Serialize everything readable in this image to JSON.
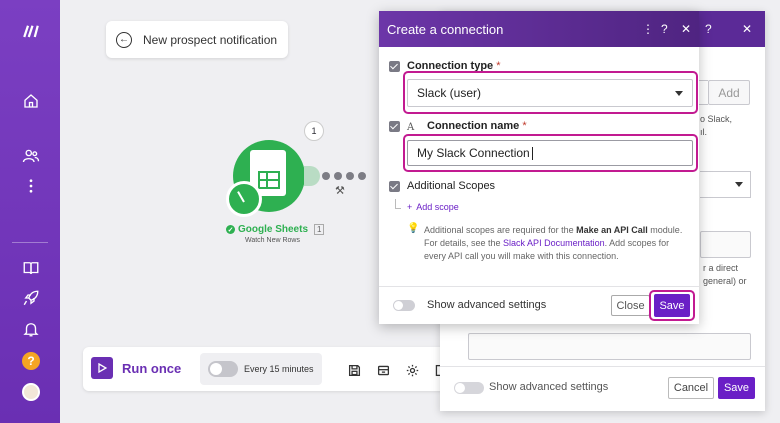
{
  "scenario": {
    "title": "New prospect notification"
  },
  "module": {
    "name": "Google Sheets",
    "index": "1",
    "subtitle": "Watch New Rows",
    "badge": "1"
  },
  "bottombar": {
    "run_label": "Run once",
    "schedule_label": "Every 15 minutes"
  },
  "modal": {
    "title": "Create a connection",
    "header_icons": [
      "more-icon",
      "help-icon",
      "close-icon"
    ],
    "connection_type": {
      "label": "Connection type",
      "required_mark": "*",
      "value": "Slack (user)"
    },
    "connection_name": {
      "label": "Connection name",
      "required_mark": "*",
      "value": "My Slack Connection",
      "type_icon": "A"
    },
    "scopes": {
      "label": "Additional Scopes",
      "add_label": "Add scope",
      "add_symbol": "+"
    },
    "help": {
      "part1": "Additional scopes are required for the ",
      "emph": "Make an API Call",
      "part2": " module. For details, see the ",
      "link": "Slack API Documentation",
      "part3": ". Add scopes for every API call you will make with this connection."
    },
    "footer": {
      "advanced_label": "Show advanced settings",
      "close_label": "Close",
      "save_label": "Save"
    }
  },
  "background_panel": {
    "add_label": "Add",
    "fragments": [
      "o Slack,",
      "ıl.",
      "r a direct",
      "general) or",
      "."
    ],
    "footer": {
      "advanced_label": "Show advanced settings",
      "cancel_label": "Cancel",
      "save_label": "Save"
    }
  },
  "colors": {
    "accent": "#6a1fc6",
    "sidebar": "#7b3fc2",
    "highlight": "#c21a91",
    "module": "#2eb051",
    "help_badge": "#f5a524"
  }
}
